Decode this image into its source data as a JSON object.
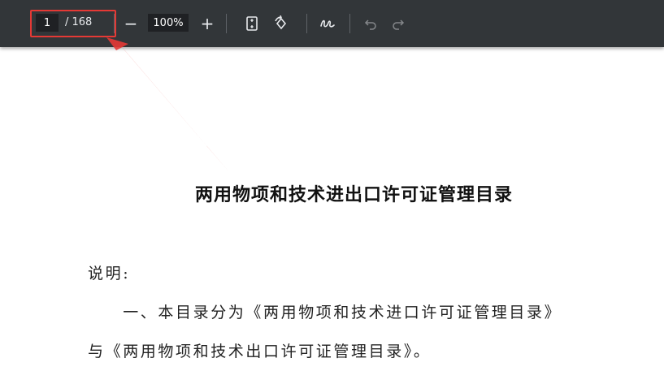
{
  "toolbar": {
    "page_current": "1",
    "page_total": "/ 168",
    "zoom_out_label": "−",
    "zoom_value": "100%",
    "zoom_in_label": "+",
    "icons": [
      "zoom-out-icon",
      "zoom-in-icon",
      "fit-page-icon",
      "rotate-icon",
      "annotate-pen-icon",
      "undo-icon",
      "redo-icon"
    ]
  },
  "document": {
    "title": "两用物项和技术进出口许可证管理目录",
    "paragraphs": [
      "说明:",
      "　　一、本目录分为《两用物项和技术进口许可证管理目录》",
      "与《两用物项和技术出口许可证管理目录》。"
    ]
  },
  "colors": {
    "toolbar_bg": "#323639",
    "highlight": "#e53935"
  }
}
